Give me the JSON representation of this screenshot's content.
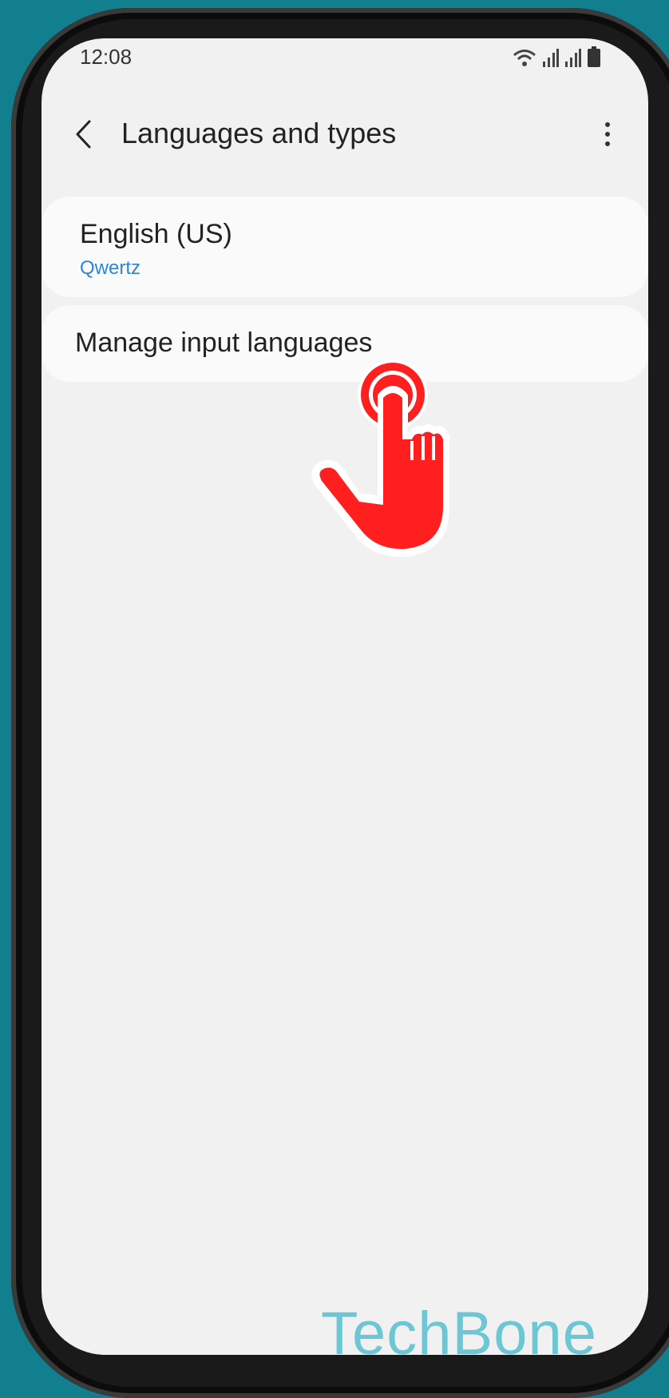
{
  "status_bar": {
    "time": "12:08",
    "icons": [
      "wifi-icon",
      "signal-icon",
      "signal-icon",
      "battery-icon"
    ]
  },
  "app_bar": {
    "title": "Languages and types",
    "back_icon": "chevron-left-icon",
    "menu_icon": "more-vertical-icon"
  },
  "language_item": {
    "name": "English (US)",
    "layout": "Qwertz"
  },
  "manage_item": {
    "label": "Manage input languages"
  },
  "overlay": {
    "gesture_icon": "tap-hand-icon",
    "gesture_color": "#ff1f1f"
  },
  "watermark": {
    "text": "TechBone"
  },
  "colors": {
    "background": "#127f8f",
    "screen": "#f1f1f1",
    "card": "#fafafa",
    "accent_link": "#2e86d6",
    "watermark": "#6cc6d3"
  }
}
